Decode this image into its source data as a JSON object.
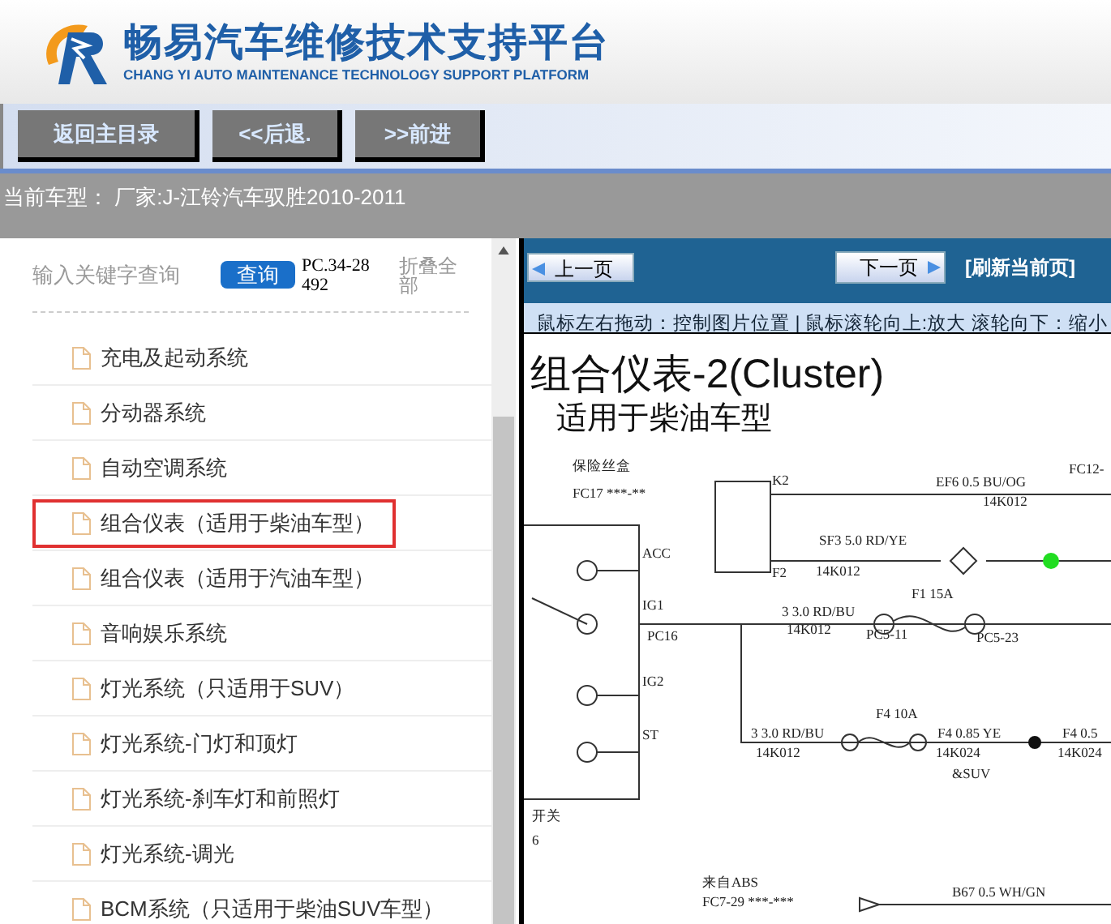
{
  "header": {
    "title": "畅易汽车维修技术支持平台",
    "subtitle": "CHANG YI AUTO MAINTENANCE TECHNOLOGY SUPPORT PLATFORM"
  },
  "nav_buttons": [
    "返回主目录",
    "<<后退.",
    ">>前进"
  ],
  "vehicle": "当前车型： 厂家:J-江铃汽车驭胜2010-2011",
  "sidebar": {
    "search": {
      "placeholder": "输入关键字查询"
    },
    "search_button": "查询",
    "code": "PC.34-28492",
    "collapse": "折叠全部",
    "items": [
      {
        "label": "充电及起动系统",
        "selected": false
      },
      {
        "label": "分动器系统",
        "selected": false
      },
      {
        "label": "自动空调系统",
        "selected": false
      },
      {
        "label": "组合仪表（适用于柴油车型）",
        "selected": true
      },
      {
        "label": "组合仪表（适用于汽油车型）",
        "selected": false
      },
      {
        "label": "音响娱乐系统",
        "selected": false
      },
      {
        "label": "灯光系统（只适用于SUV）",
        "selected": false
      },
      {
        "label": "灯光系统-门灯和顶灯",
        "selected": false
      },
      {
        "label": "灯光系统-刹车灯和前照灯",
        "selected": false
      },
      {
        "label": "灯光系统-调光",
        "selected": false
      },
      {
        "label": "BCM系统（只适用于柴油SUV车型）",
        "selected": false
      }
    ]
  },
  "viewer": {
    "prev": "上一页",
    "next": "下一页",
    "refresh": "[刷新当前页]",
    "hint": "鼠标左右拖动：控制图片位置 | 鼠标滚轮向上:放大  滚轮向下：缩小",
    "title": "组合仪表-2(Cluster)",
    "subtitle": "适用于柴油车型",
    "labels": [
      "保险丝盒",
      "FC17 ***-**",
      "K2",
      "F2",
      "EF6 0.5 BU/OG",
      "14K012",
      "FC12-",
      "SF3 5.0 RD/YE",
      "14K012",
      "ACC",
      "IG1",
      "PC16",
      "IG2",
      "ST",
      "3 3.0 RD/BU",
      "14K012",
      "F1 15A",
      "PC5-11",
      "PC5-23",
      "3 3.0 RD/BU",
      "14K012",
      "F4 10A",
      "F4 0.85 YE",
      "14K024",
      "&SUV",
      "F4 0.5",
      "14K024",
      "开关",
      "6",
      "来自ABS",
      "FC7-29 ***-***",
      "B67 0.5 WH/GN"
    ]
  }
}
